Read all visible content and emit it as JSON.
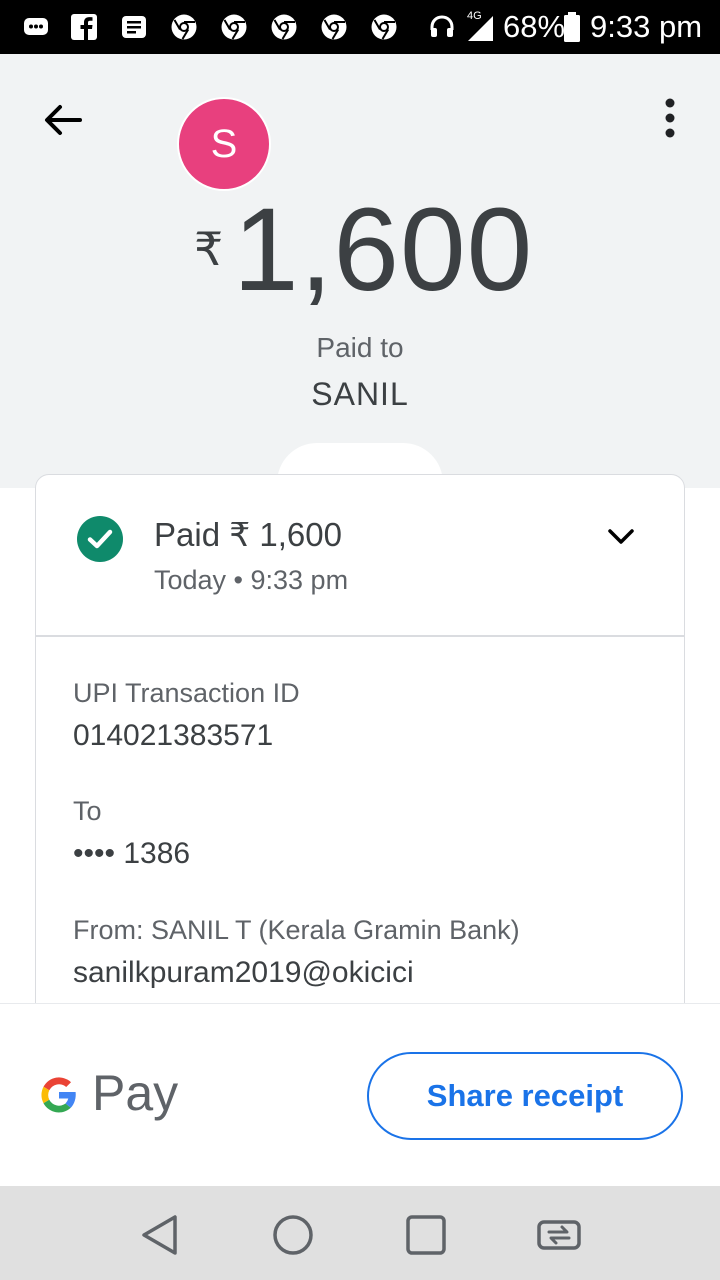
{
  "status_bar": {
    "network": "4G",
    "battery": "68%",
    "time": "9:33 pm"
  },
  "header": {
    "avatar_letter": "S",
    "currency_symbol": "₹",
    "amount": "1,600",
    "paid_to_label": "Paid to",
    "payee_name": "SANIL"
  },
  "transaction": {
    "status_title": "Paid ₹ 1,600",
    "status_time": "Today • 9:33 pm",
    "upi_label": "UPI Transaction ID",
    "upi_value": "014021383571",
    "to_label": "To",
    "to_value": "•••• 1386",
    "from_label": "From: SANIL T (Kerala Gramin Bank)",
    "from_value": "sanilkpuram2019@okicici"
  },
  "footer": {
    "brand_text": "Pay",
    "share_label": "Share receipt"
  },
  "colors": {
    "accent": "#1a73e8",
    "avatar": "#e8407e",
    "success": "#0f8a6b"
  }
}
